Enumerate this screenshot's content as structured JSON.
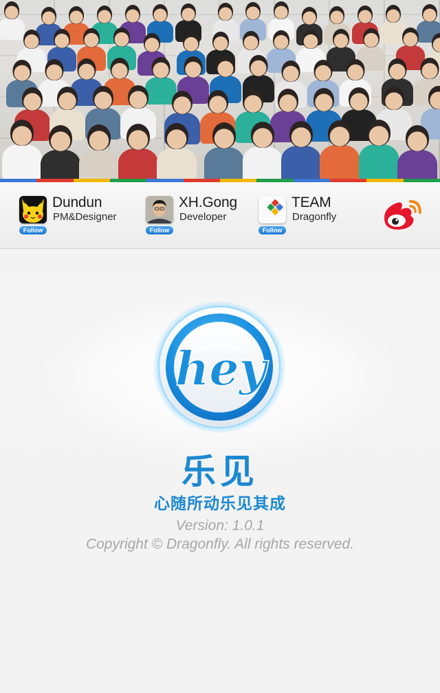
{
  "header": {
    "photo": {
      "icon": "team-photo"
    },
    "stripe_colors": [
      "#3c78d8",
      "#e03a2f",
      "#f2b705",
      "#1f9e4a",
      "#3c78d8",
      "#e03a2f",
      "#f2b705",
      "#1f9e4a",
      "#3c78d8",
      "#e03a2f",
      "#f2b705",
      "#1f9e4a"
    ]
  },
  "profiles": [
    {
      "name": "Dundun",
      "role": "PM&Designer",
      "follow_label": "Follow",
      "icon": "pikachu-avatar-icon"
    },
    {
      "name": "XH.Gong",
      "role": "Developer",
      "follow_label": "Follow",
      "icon": "person-avatar-icon"
    },
    {
      "name": "TEAM",
      "role": "Dragonfly",
      "follow_label": "Follow",
      "icon": "team-logo-icon"
    }
  ],
  "weibo": {
    "icon": "weibo-icon",
    "color": "#e6162d"
  },
  "app": {
    "logo_text": "hey",
    "name": "乐见",
    "slogan": "心随所动乐见其成",
    "version": "Version: 1.0.1",
    "copyright": "Copyright © Dragonfly. All rights reserved.",
    "accent_color": "#1c88d1"
  }
}
